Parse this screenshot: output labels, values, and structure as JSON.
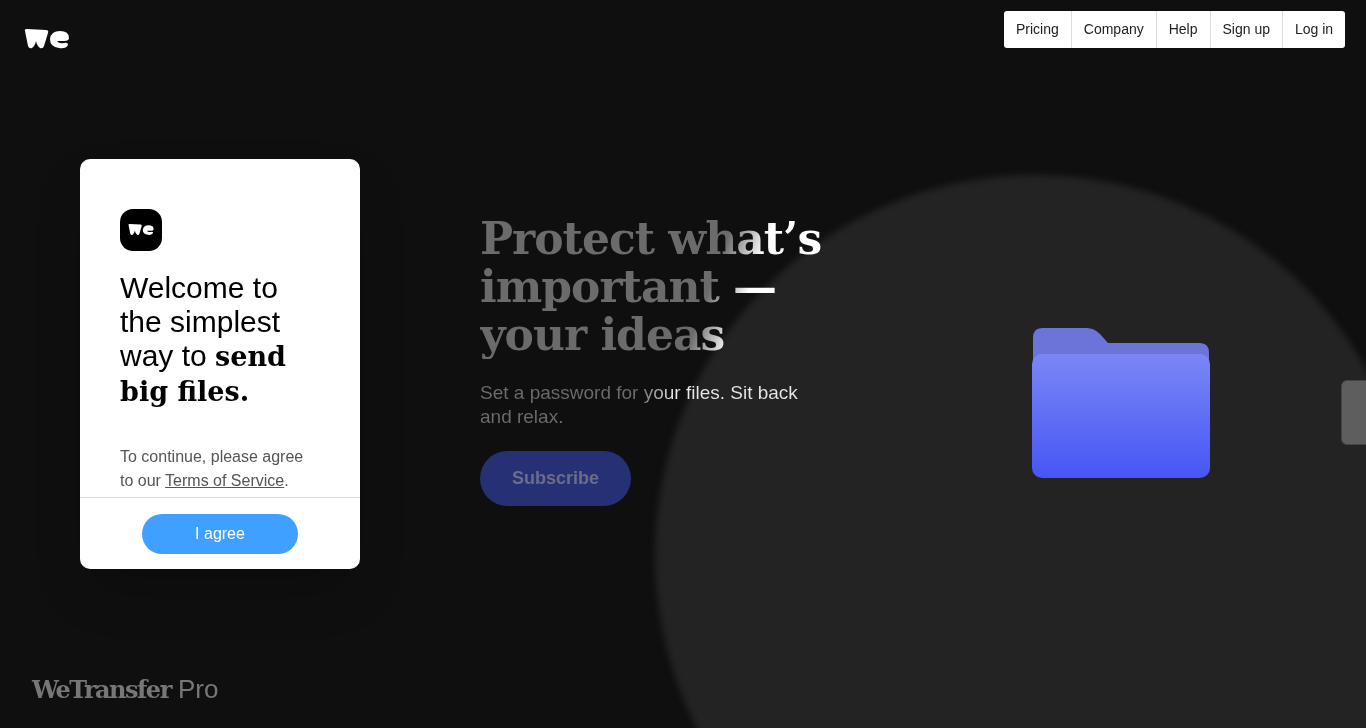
{
  "nav": {
    "links": [
      "Pricing",
      "Company",
      "Help",
      "Sign up",
      "Log in"
    ]
  },
  "dialog": {
    "heading": "Welcome to the simplest way to **send big files.**",
    "text_before": "To continue, please agree to our ",
    "link": "Terms of Service",
    "text_after": ".",
    "button": "I agree"
  },
  "hero": {
    "heading": "Protect what’s important —your ideas",
    "body": "Set a password for your files. Sit back and relax.",
    "button": "Subscribe"
  },
  "footer": {
    "brand": "WeTransfer",
    "product": "Pro"
  }
}
